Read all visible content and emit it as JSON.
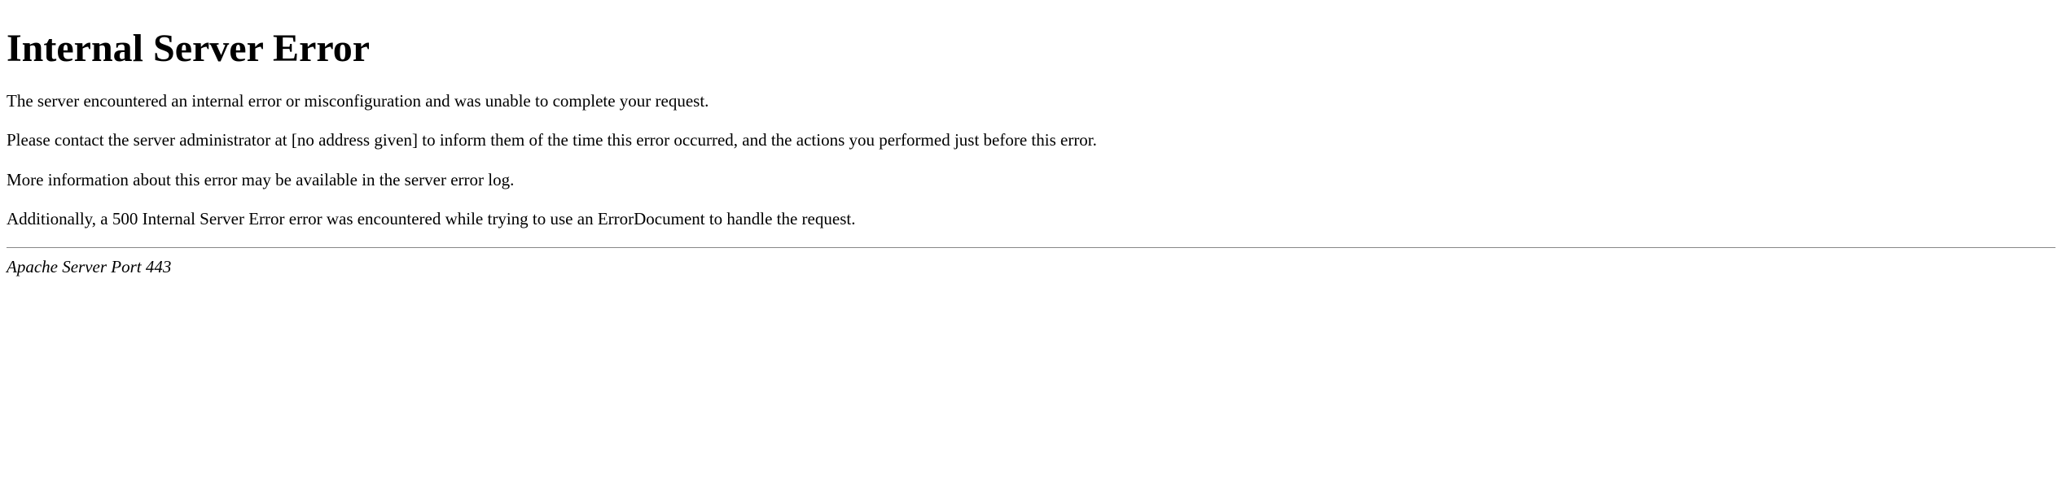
{
  "title": "Internal Server Error",
  "paragraphs": [
    "The server encountered an internal error or misconfiguration and was unable to complete your request.",
    "Please contact the server administrator at [no address given] to inform them of the time this error occurred, and the actions you performed just before this error.",
    "More information about this error may be available in the server error log.",
    "Additionally, a 500 Internal Server Error error was encountered while trying to use an ErrorDocument to handle the request."
  ],
  "server_signature": "Apache Server Port 443"
}
